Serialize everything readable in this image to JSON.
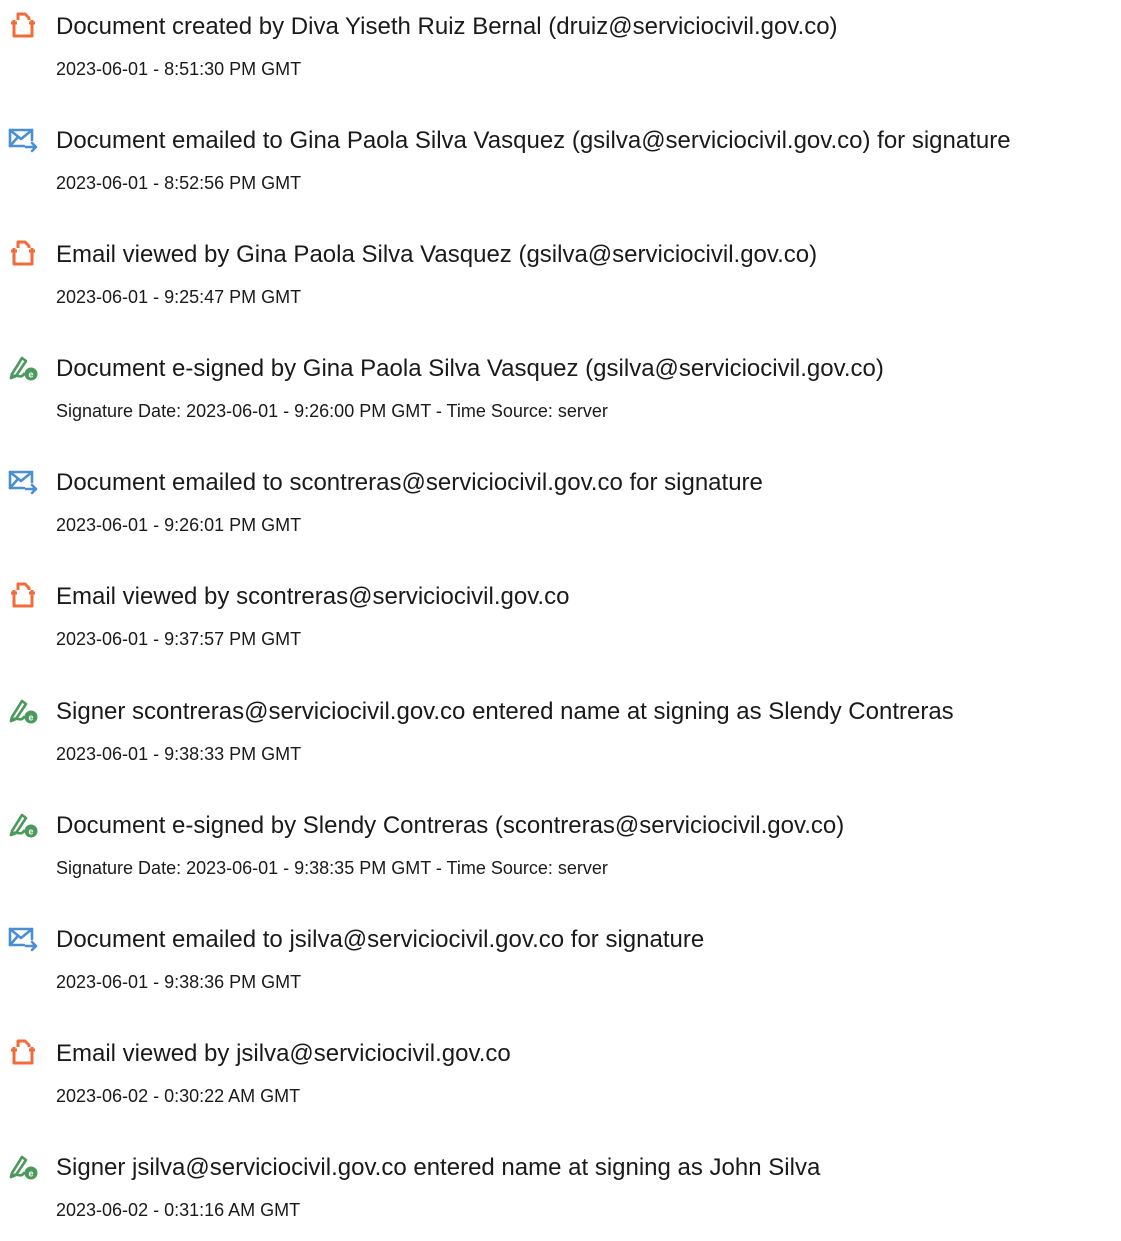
{
  "colors": {
    "document_icon": "#f26b3a",
    "email_icon": "#4a8fd6",
    "sign_icon": "#4a9a5c"
  },
  "events": [
    {
      "icon": "document-icon",
      "text": "Document created by Diva Yiseth Ruiz Bernal (druiz@serviciocivil.gov.co)",
      "meta": "2023-06-01 - 8:51:30 PM GMT"
    },
    {
      "icon": "email-send-icon",
      "text": "Document emailed to Gina Paola Silva Vasquez (gsilva@serviciocivil.gov.co) for signature",
      "meta": "2023-06-01 - 8:52:56 PM GMT"
    },
    {
      "icon": "document-icon",
      "text": "Email viewed by Gina Paola Silva Vasquez (gsilva@serviciocivil.gov.co)",
      "meta": "2023-06-01 - 9:25:47 PM GMT"
    },
    {
      "icon": "e-sign-icon",
      "text": "Document e-signed by Gina Paola Silva Vasquez (gsilva@serviciocivil.gov.co)",
      "meta": "Signature Date: 2023-06-01 - 9:26:00 PM GMT - Time Source: server"
    },
    {
      "icon": "email-send-icon",
      "text": "Document emailed to scontreras@serviciocivil.gov.co for signature",
      "meta": "2023-06-01 - 9:26:01 PM GMT"
    },
    {
      "icon": "document-icon",
      "text": "Email viewed by scontreras@serviciocivil.gov.co",
      "meta": "2023-06-01 - 9:37:57 PM GMT"
    },
    {
      "icon": "e-sign-icon",
      "text": "Signer scontreras@serviciocivil.gov.co entered name at signing as Slendy Contreras",
      "meta": "2023-06-01 - 9:38:33 PM GMT"
    },
    {
      "icon": "e-sign-icon",
      "text": "Document e-signed by Slendy Contreras (scontreras@serviciocivil.gov.co)",
      "meta": "Signature Date: 2023-06-01 - 9:38:35 PM GMT - Time Source: server"
    },
    {
      "icon": "email-send-icon",
      "text": "Document emailed to jsilva@serviciocivil.gov.co for signature",
      "meta": "2023-06-01 - 9:38:36 PM GMT"
    },
    {
      "icon": "document-icon",
      "text": "Email viewed by jsilva@serviciocivil.gov.co",
      "meta": "2023-06-02 - 0:30:22 AM GMT"
    },
    {
      "icon": "e-sign-icon",
      "text": "Signer jsilva@serviciocivil.gov.co entered name at signing as John Silva",
      "meta": "2023-06-02 - 0:31:16 AM GMT"
    }
  ]
}
